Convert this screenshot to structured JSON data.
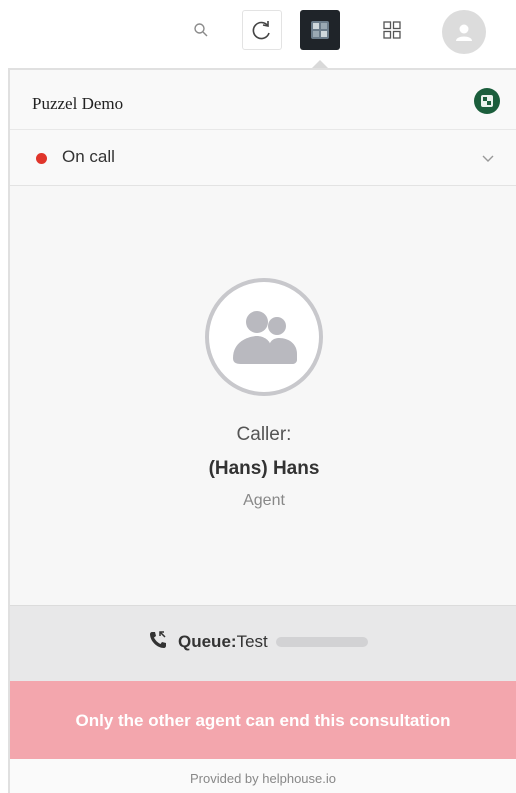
{
  "toolbar": {
    "icons": [
      "search-icon",
      "refresh-icon",
      "extension-icon",
      "apps-grid-icon",
      "user-avatar-icon"
    ]
  },
  "panel": {
    "title": "Puzzel Demo",
    "logo": "puzzel-logo-icon"
  },
  "status": {
    "label": "On call",
    "dot_color": "#e0352b"
  },
  "caller": {
    "label": "Caller:",
    "name": "(Hans) Hans",
    "role": "Agent"
  },
  "queue": {
    "key": "Queue:",
    "value": "Test"
  },
  "warning": {
    "text": "Only the other agent can end this consultation",
    "color": "#f3a6ad"
  },
  "footer": {
    "text": "Provided by helphouse.io"
  }
}
